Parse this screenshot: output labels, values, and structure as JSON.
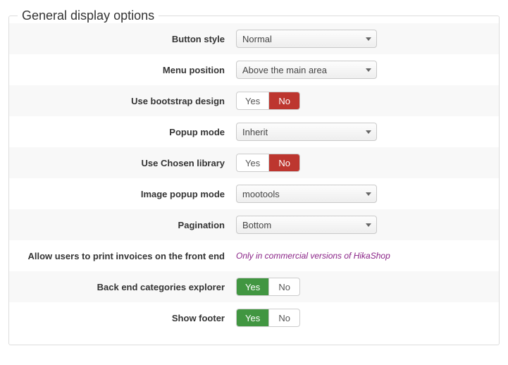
{
  "legend": "General display options",
  "yes": "Yes",
  "no": "No",
  "rows": {
    "button_style": {
      "label": "Button style",
      "value": "Normal"
    },
    "menu_position": {
      "label": "Menu position",
      "value": "Above the main area"
    },
    "bootstrap": {
      "label": "Use bootstrap design",
      "value": "no"
    },
    "popup_mode": {
      "label": "Popup mode",
      "value": "Inherit"
    },
    "chosen": {
      "label": "Use Chosen library",
      "value": "no"
    },
    "image_popup": {
      "label": "Image popup mode",
      "value": "mootools"
    },
    "pagination": {
      "label": "Pagination",
      "value": "Bottom"
    },
    "invoices": {
      "label": "Allow users to print invoices on the front end",
      "note": "Only in commercial versions of HikaShop"
    },
    "backend_explorer": {
      "label": "Back end categories explorer",
      "value": "yes"
    },
    "show_footer": {
      "label": "Show footer",
      "value": "yes"
    }
  }
}
